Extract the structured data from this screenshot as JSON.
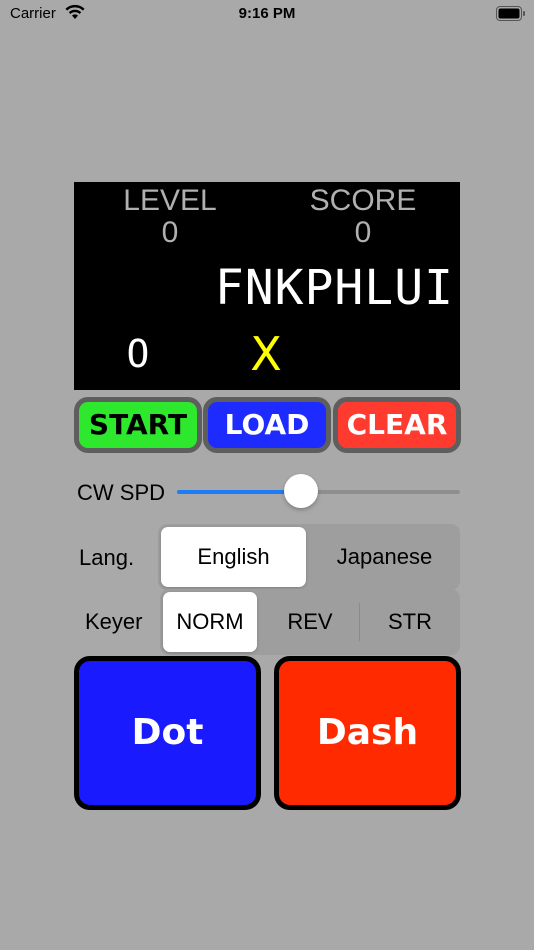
{
  "status_bar": {
    "carrier": "Carrier",
    "time": "9:16 PM"
  },
  "display": {
    "level_label": "LEVEL",
    "level_value": "0",
    "score_label": "SCORE",
    "score_value": "0",
    "target_word": "FNKPHLUI",
    "input_char": "O",
    "result_mark": "X"
  },
  "controls": {
    "start_label": "START",
    "load_label": "LOAD",
    "clear_label": "CLEAR"
  },
  "speed": {
    "label": "CW SPD",
    "value_fraction": 0.44
  },
  "language": {
    "label": "Lang.",
    "options": [
      "English",
      "Japanese"
    ],
    "selected": "English"
  },
  "keyer": {
    "label": "Keyer",
    "options": [
      "NORM",
      "REV",
      "STR"
    ],
    "selected": "NORM"
  },
  "keys": {
    "dot_label": "Dot",
    "dash_label": "Dash"
  },
  "colors": {
    "background": "#a9a9a9",
    "start": "#2ee82e",
    "load": "#1d2bff",
    "clear": "#ff3b30",
    "dot": "#1a1aff",
    "dash": "#ff2a00",
    "slider_accent": "#1e7cf7",
    "result_mark": "#ffff00"
  }
}
